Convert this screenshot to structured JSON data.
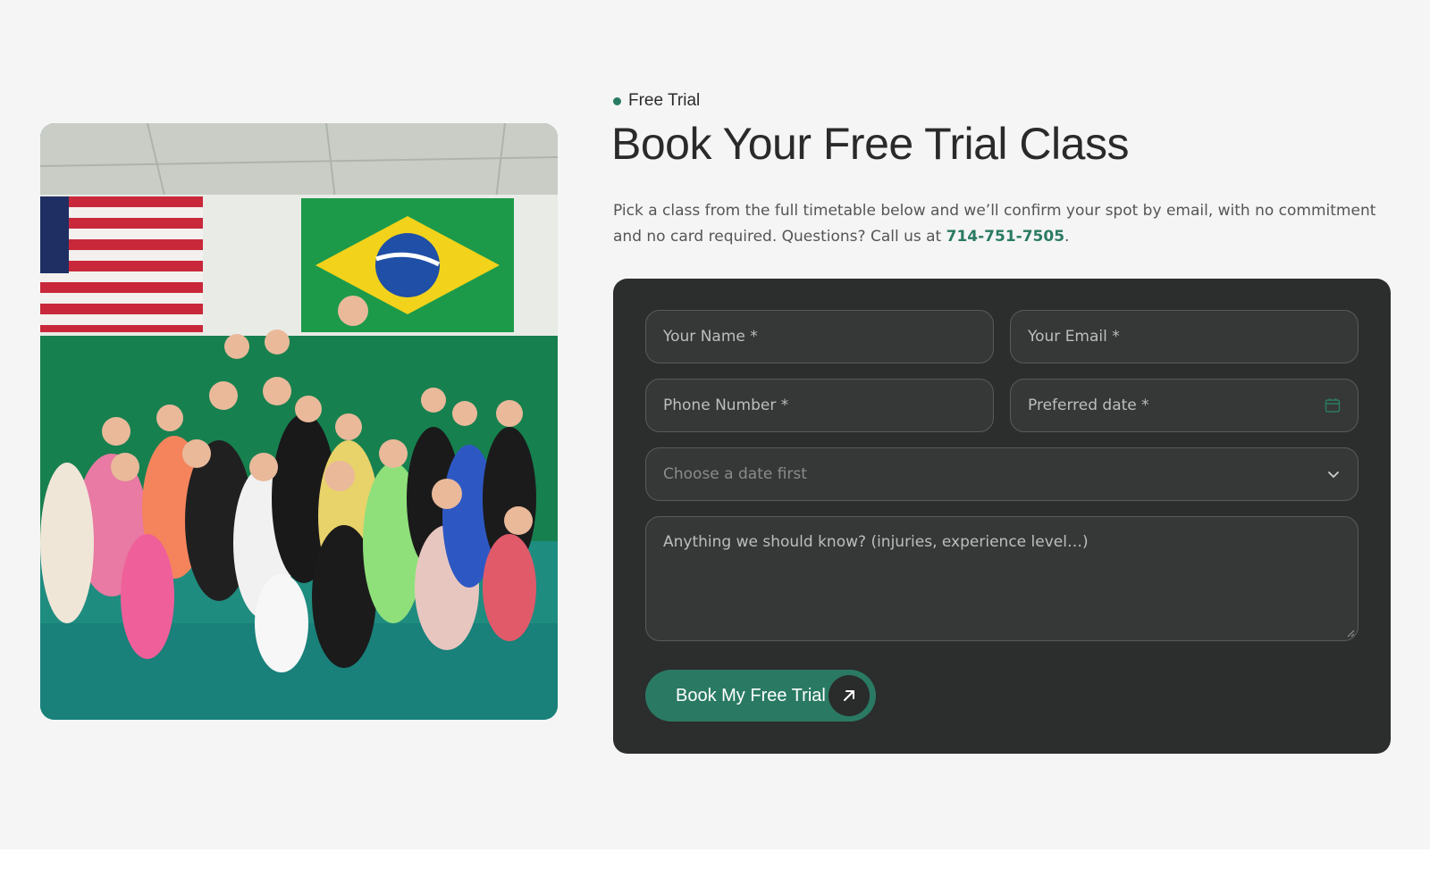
{
  "colors": {
    "accent": "#2a7a63",
    "card_bg": "#2c2d2d",
    "field_bg": "#363837",
    "page_bg": "#f5f5f5"
  },
  "photo": {
    "description_icon": "group-photo-image"
  },
  "header": {
    "eyebrow": "Free Trial",
    "title": "Book Your Free Trial Class"
  },
  "description": {
    "text_before": "Pick a class from the full timetable below and we’ll confirm your spot by email, with no commitment and no card required. Questions? Call us at ",
    "phone": "714-751-7505",
    "text_after": "."
  },
  "form": {
    "name_placeholder": "Your Name *",
    "email_placeholder": "Your Email *",
    "phone_placeholder": "Phone Number *",
    "date_placeholder": "Preferred date *",
    "date_icon": "calendar-icon",
    "class_select_placeholder": "Choose a date first",
    "class_select_icon": "chevron-down-icon",
    "notes_placeholder": "Anything we should know? (injuries, experience level…)",
    "submit_label": "Book My Free Trial",
    "submit_icon": "arrow-up-right-icon"
  }
}
